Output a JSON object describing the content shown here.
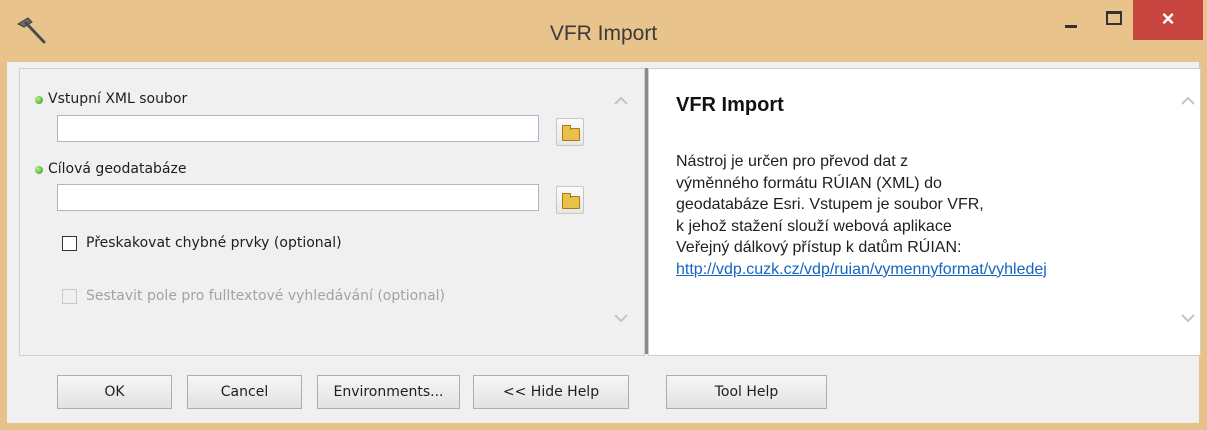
{
  "window": {
    "title": "VFR Import",
    "close_glyph": "×"
  },
  "params": {
    "input_xml_label": "Vstupní XML soubor",
    "input_xml_value": "",
    "target_gdb_label": "Cílová geodatabáze",
    "target_gdb_value": "",
    "skip_errors_label": "Přeskakovat chybné prvky (optional)",
    "skip_errors_checked": false,
    "fulltext_label": "Sestavit pole pro fulltextové vyhledávání (optional)",
    "fulltext_checked": false,
    "fulltext_enabled": false
  },
  "help": {
    "title": "VFR Import",
    "body": "Nástroj je určen pro převod dat z výměnného formátu RÚIAN (XML) do geodatabáze Esri. Vstupem je soubor VFR, k jehož stažení slouží webová aplikace Veřejný dálkový přístup k datům RÚIAN:",
    "link": "http://vdp.cuzk.cz/vdp/ruian/vymennyformat/vyhledej"
  },
  "buttons": {
    "ok": "OK",
    "cancel": "Cancel",
    "environments": "Environments...",
    "hide_help": "<< Hide Help",
    "tool_help": "Tool Help"
  },
  "icons": {
    "title_icon": "hammer-icon",
    "browse_icon": "open-folder-icon",
    "required_icon": "green-dot-icon",
    "scroll_up": "chevron-up-icon",
    "scroll_down": "chevron-down-icon"
  }
}
